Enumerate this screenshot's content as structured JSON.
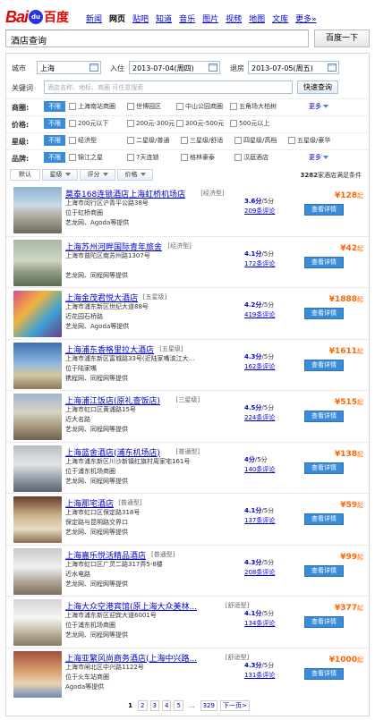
{
  "logo": {
    "text1": "Bai",
    "text2": "du",
    "text3": "百度"
  },
  "nav": [
    "新闻",
    "网页",
    "贴吧",
    "知道",
    "音乐",
    "图片",
    "视频",
    "地图",
    "文库",
    "更多»"
  ],
  "search": {
    "value": "酒店查询",
    "button": "百度一下"
  },
  "filters": {
    "city_label": "城市",
    "city": "上海",
    "checkin_label": "入住",
    "checkin": "2013-07-04(周四)",
    "checkout_label": "退房",
    "checkout": "2013-07-05(周五)",
    "keyword_label": "关键词",
    "keyword_placeholder": "酒店名称、地标、商圈 可任意搜索",
    "query_button": "快速查询",
    "unlimited": "不限",
    "more": "更多",
    "rows": [
      {
        "label": "商圈:",
        "options": [
          "上海南站商圈",
          "世博园区",
          "中山公园商圈",
          "五角场大柏树"
        ]
      },
      {
        "label": "价格:",
        "options": [
          "200元以下",
          "200元-300元",
          "300元-500元",
          "500元以上"
        ]
      },
      {
        "label": "星级:",
        "options": [
          "经济型",
          "二星级/普通",
          "三星级/舒适",
          "四星级/高档",
          "五星级/豪华"
        ]
      },
      {
        "label": "品牌:",
        "options": [
          "锦江之星",
          "7天连锁",
          "格林豪泰",
          "汉庭酒店"
        ]
      }
    ]
  },
  "sort": {
    "default": "默认",
    "star": "星级",
    "score": "评分",
    "price": "价格",
    "count_num": "3282",
    "count_text": "家酒店满足条件"
  },
  "hotels": [
    {
      "name": "莫泰168连锁酒店上海虹桥机场店",
      "type": "[经济型]",
      "addr": "上海市闵行区沪青平公路38号",
      "near": "位于虹桥商圈",
      "src": "艺龙网、Agoda等提供",
      "score": "3.6分",
      "score_suffix": "/5分",
      "reviews": "209条评论",
      "price": "¥128",
      "price_suffix": "起",
      "detail": "查看详情"
    },
    {
      "name": "上海苏州河畔国际青年旅舍",
      "type": "[经济型]",
      "addr": "上海市普陀区南苏州路1307号",
      "near": "",
      "src": "艺龙网、同程网等提供",
      "score": "4.1分",
      "score_suffix": "/5分",
      "reviews": "172条评论",
      "price": "¥42",
      "price_suffix": "起",
      "detail": "查看详情"
    },
    {
      "name": "上海金茂君悦大酒店",
      "type": "[五星级]",
      "addr": "上海市浦东新区世纪大道88号",
      "near": "近花园石桥路",
      "src": "艺龙网、Agoda等提供",
      "score": "4.2分",
      "score_suffix": "/5分",
      "reviews": "419条评论",
      "price": "¥1888",
      "price_suffix": "起",
      "detail": "查看详情"
    },
    {
      "name": "上海浦东香格里拉大酒店",
      "type": "[五星级]",
      "addr": "上海市浦东新区富城路33号(近陆家嘴滨江大...",
      "near": "位于陆家嘴",
      "src": "携程网、同程网等提供",
      "score": "4.3分",
      "score_suffix": "/5分",
      "reviews": "162条评论",
      "price": "¥1611",
      "price_suffix": "起",
      "detail": "查看详情"
    },
    {
      "name": "上海浦江饭店(原礼查饭店)",
      "type": "[三星级]",
      "addr": "上海市虹口区黄浦路15号",
      "near": "近大名路",
      "src": "艺龙网、同程网等提供",
      "score": "4.5分",
      "score_suffix": "/5分",
      "reviews": "224条评论",
      "price": "¥515",
      "price_suffix": "起",
      "detail": "查看详情"
    },
    {
      "name": "上海蓝舍酒店(浦东机场店)",
      "type": "[普通型]",
      "addr": "上海市浦东新区川沙新镇红旗村周家宅161号",
      "near": "位于浦东机场商圈",
      "src": "艺龙网、同程网等提供",
      "score": "4分",
      "score_suffix": "/5分",
      "reviews": "140条评论",
      "price": "¥138",
      "price_suffix": "起",
      "detail": "查看详情"
    },
    {
      "name": "上海那宅酒店",
      "type": "[普通型]",
      "addr": "上海市虹口区保定路318号",
      "near": "保定路与昆明路交界口",
      "src": "艺龙网、同程网等提供",
      "score": "4.1分",
      "score_suffix": "/5分",
      "reviews": "137条评论",
      "price": "¥59",
      "price_suffix": "起",
      "detail": "查看详情"
    },
    {
      "name": "上海嘉乐悦活精品酒店",
      "type": "[普通型]",
      "addr": "上海市虹口区广灵二路317弄5-8楼",
      "near": "近水电路",
      "src": "艺龙网、同程网等提供",
      "score": "4.3分",
      "score_suffix": "/5分",
      "reviews": "208条评论",
      "price": "¥99",
      "price_suffix": "起",
      "detail": "查看详情"
    },
    {
      "name": "上海大众空港宾馆(原上海大众美林...",
      "type": "[舒适型]",
      "addr": "上海市浦东新区迎宾大道6001号",
      "near": "位于浦东机场商圈",
      "src": "艺龙网、同程网等提供",
      "score": "4.1分",
      "score_suffix": "/5分",
      "reviews": "134条评论",
      "price": "¥377",
      "price_suffix": "起",
      "detail": "查看详情"
    },
    {
      "name": "上海亚繁风尚商务酒店(上海中兴路...",
      "type": "[舒适型]",
      "addr": "上海市闸北区中兴路1122号",
      "near": "位于火车站商圈",
      "src": "Agoda等提供",
      "score": "4.3分",
      "score_suffix": "/5分",
      "reviews": "131条评论",
      "price": "¥1000",
      "price_suffix": "起",
      "detail": "查看详情"
    }
  ],
  "pager": {
    "pages": [
      "1",
      "2",
      "3",
      "4",
      "5"
    ],
    "ellipsis": "...",
    "last": "329",
    "next": "下一页>"
  },
  "colors": {
    "accent": "#3a8cd8",
    "link": "#0000cc",
    "price": "#ff6600",
    "brand_red": "#e10602"
  }
}
